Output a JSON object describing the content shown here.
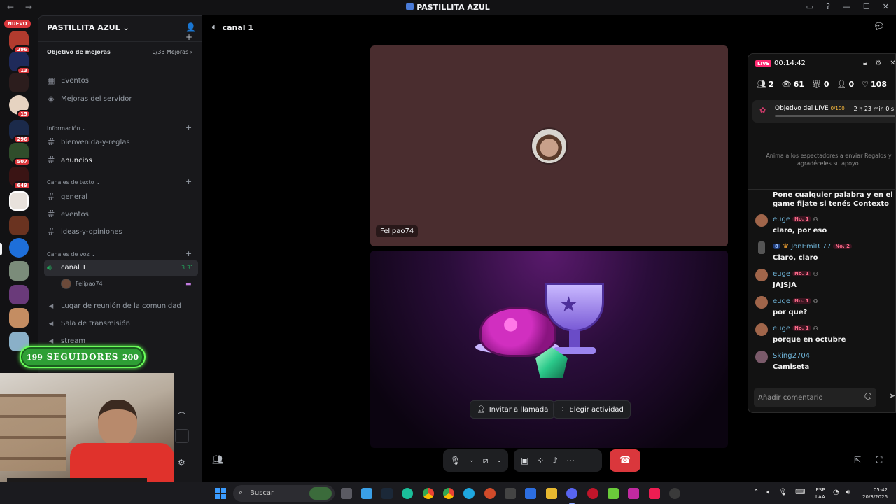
{
  "window": {
    "title": "PASTILLITA AZUL",
    "nav_arrows": "← →"
  },
  "rail": {
    "new_label": "NUEVO",
    "badges": [
      "296",
      "13",
      "15",
      "296",
      "507",
      "649"
    ]
  },
  "sidebar": {
    "server_name": "PASTILLITA AZUL",
    "boost_goal_label": "Objetivo de mejoras",
    "boost_goal_value": "0/33 Mejoras",
    "events_label": "Eventos",
    "boosts_label": "Mejoras del servidor",
    "categories": {
      "info": "Información",
      "text": "Canales de texto",
      "voice": "Canales de voz"
    },
    "info_channels": [
      "bienvenida-y-reglas",
      "anuncios"
    ],
    "text_channels": [
      "general",
      "eventos",
      "ideas-y-opiniones"
    ],
    "voice_active": {
      "name": "canal 1",
      "time": "3:31",
      "user": "Felipao74"
    },
    "voice_channels": [
      "Lugar de reunión de la comunidad",
      "Sala de transmisión",
      "stream"
    ]
  },
  "followers": {
    "current": "199",
    "label": "SEGUIDORES",
    "goal": "200",
    "progress": 0.995
  },
  "main": {
    "channel_name": "canal 1",
    "tile_user": "Felipao74",
    "invite_button": "Invitar a llamada",
    "activity_button": "Elegir actividad"
  },
  "live": {
    "badge": "LIVE",
    "time": "00:14:42",
    "stats": {
      "users": "2",
      "views": "61",
      "gifts": "0",
      "follows": "0",
      "likes": "108"
    },
    "goal_title": "Objetivo del LIVE",
    "goal_count": "0/100",
    "goal_time": "2 h 23 min 0 s",
    "hint": "Anima a los espectadores a enviar Regalos y agradéceles su apoyo.",
    "top_message": "Pone cualquier palabra y en el game fijate si tenés Contexto",
    "messages": [
      {
        "user": "euge",
        "badge": "No. 1",
        "text": "claro, por eso"
      },
      {
        "user": "JonEmiR 77",
        "badge": "No. 2",
        "level": "8",
        "text": "Claro, claro"
      },
      {
        "user": "euge",
        "badge": "No. 1",
        "text": "JAJSJA"
      },
      {
        "user": "euge",
        "badge": "No. 1",
        "text": "por que?"
      },
      {
        "user": "euge",
        "badge": "No. 1",
        "text": "porque en octubre"
      },
      {
        "user": "Sking2704",
        "text": "Camiseta"
      }
    ],
    "input_placeholder": "Añadir comentario"
  },
  "taskbar": {
    "search": "Buscar",
    "lang_1": "ESP",
    "lang_2": "LAA",
    "time": "05:42",
    "date": "20/3/2026"
  },
  "colors": {
    "accent_green": "#23a55a",
    "hangup_red": "#da373c",
    "live_pink": "#ff2b72",
    "tile_bg": "#4a2d2f"
  }
}
